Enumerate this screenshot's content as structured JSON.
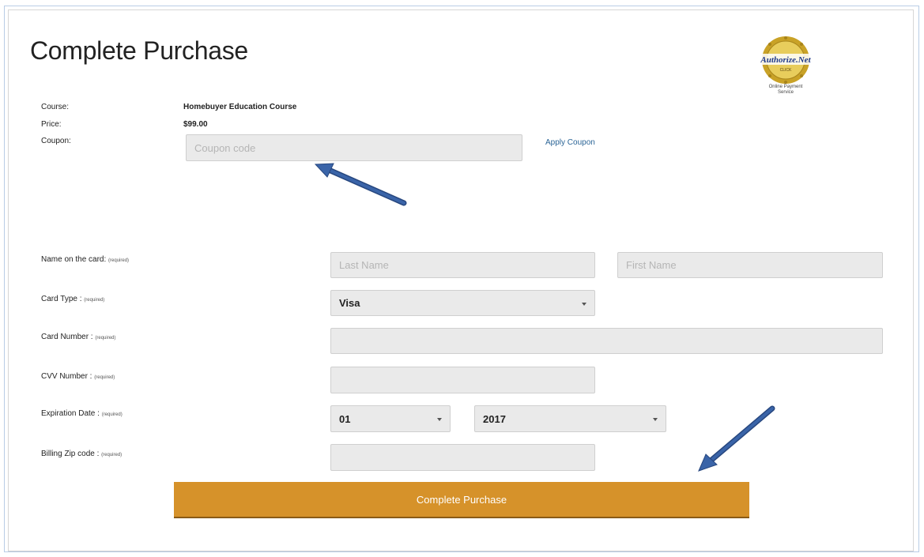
{
  "page": {
    "title": "Complete Purchase"
  },
  "seal": {
    "brand": "Authorize.Net",
    "sub": "CLICK",
    "caption_line1": "Online Payment",
    "caption_line2": "Service",
    "gold_color": "#c9a227",
    "text_color": "#1f3a8a"
  },
  "summary": {
    "course_label": "Course:",
    "course_value": "Homebuyer Education Course",
    "price_label": "Price:",
    "price_value": "$99.00",
    "coupon_label": "Coupon:",
    "coupon_placeholder": "Coupon code",
    "coupon_value": "",
    "apply_label": "Apply Coupon"
  },
  "form": {
    "required_text": "(required)",
    "name": {
      "label": "Name on the card:",
      "last_placeholder": "Last Name",
      "first_placeholder": "First Name"
    },
    "card_type": {
      "label": "Card Type :",
      "selected": "Visa"
    },
    "card_number": {
      "label": "Card Number :",
      "value": ""
    },
    "cvv": {
      "label": "CVV Number :",
      "value": ""
    },
    "expiration": {
      "label": "Expiration Date :",
      "month": "01",
      "year": "2017"
    },
    "zip": {
      "label": "Billing Zip code :",
      "value": ""
    }
  },
  "submit": {
    "label": "Complete Purchase",
    "color": "#d6922a"
  },
  "annotations": {
    "arrow_color": "#3a64a8",
    "arrow_icons": [
      "arrow-to-coupon-icon",
      "arrow-to-submit-icon"
    ]
  }
}
